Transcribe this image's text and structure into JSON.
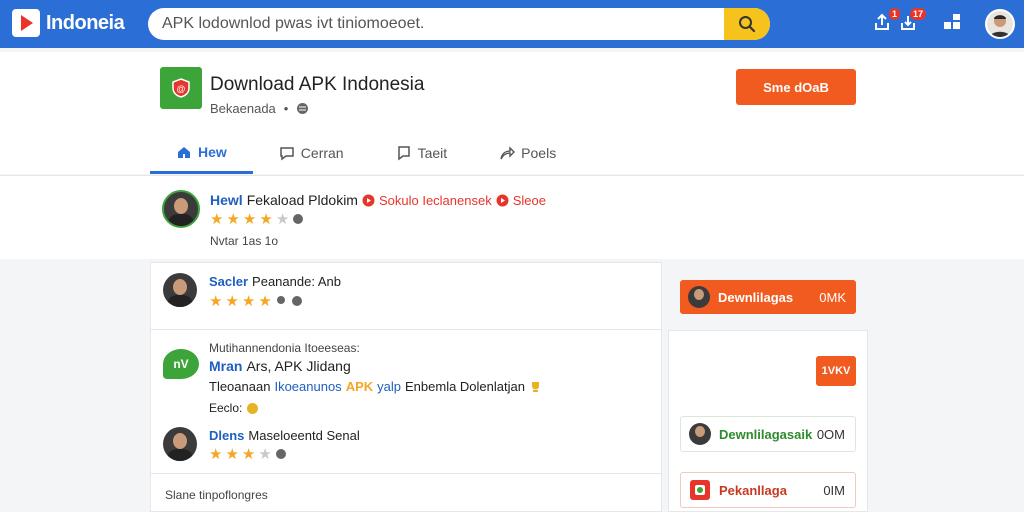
{
  "brand": {
    "name": "Indoneia"
  },
  "search": {
    "value": "APK lodownlod pwas ivt tiniomoeoet.",
    "placeholder": ""
  },
  "topbar": {
    "icons": [
      {
        "name": "upload-icon",
        "badge": "1"
      },
      {
        "name": "notification-icon",
        "badge": "17"
      },
      {
        "name": "apps-icon",
        "badge": ""
      }
    ]
  },
  "app": {
    "title": "Download APK Indonesia",
    "subtitle": "Bekaenada",
    "subtitle_sep": "•",
    "primary_button": "Sme dOaB"
  },
  "tabs": [
    {
      "label": "Hew",
      "icon": "home-icon",
      "active": true
    },
    {
      "label": "Cerran",
      "icon": "comment-icon",
      "active": false
    },
    {
      "label": "Taeit",
      "icon": "chat-icon",
      "active": false
    },
    {
      "label": "Poels",
      "icon": "share-icon",
      "active": false
    }
  ],
  "featured": {
    "name": "Hewl",
    "title": "Fekaload Pldokim",
    "tag1": "Sokulo Ieclanensek",
    "tag2": "Sleoe",
    "rating": 4,
    "meta": "Nvtar 1as 1o"
  },
  "list": {
    "item1": {
      "name": "Sacler",
      "rest": "Peanande: Anb",
      "rating": 4
    },
    "item2": {
      "heading": "Mutihannendonia Itoeeseas:",
      "title_blue": "Mran",
      "title_rest": "Ars, APK Jlidang",
      "line_a": "Tleoanaan",
      "line_blue": "Ikoeanunos",
      "line_orange": "APK",
      "line_blue2": "yalp",
      "line_rest": "Enbemla Dolenlatjan",
      "footer": "Eeclo:",
      "icon_label": "nV"
    },
    "item3": {
      "name": "Dlens",
      "rest": "Maseloeentd Senal",
      "rating": 3
    },
    "bottom": "Slane tinpoflongres"
  },
  "sidebar": {
    "btn1": {
      "label": "Dewnlilagas",
      "size": "0MK"
    },
    "btn2": {
      "label": "1VKV"
    },
    "item1": {
      "label": "Dewnlilagasaik",
      "size": "0OM"
    },
    "item2": {
      "label": "Pekanllaga",
      "size": "0IM"
    }
  },
  "colors": {
    "primary": "#2b6fd6",
    "accent": "#f25b1f",
    "green": "#3da43a",
    "star": "#f5a623"
  }
}
